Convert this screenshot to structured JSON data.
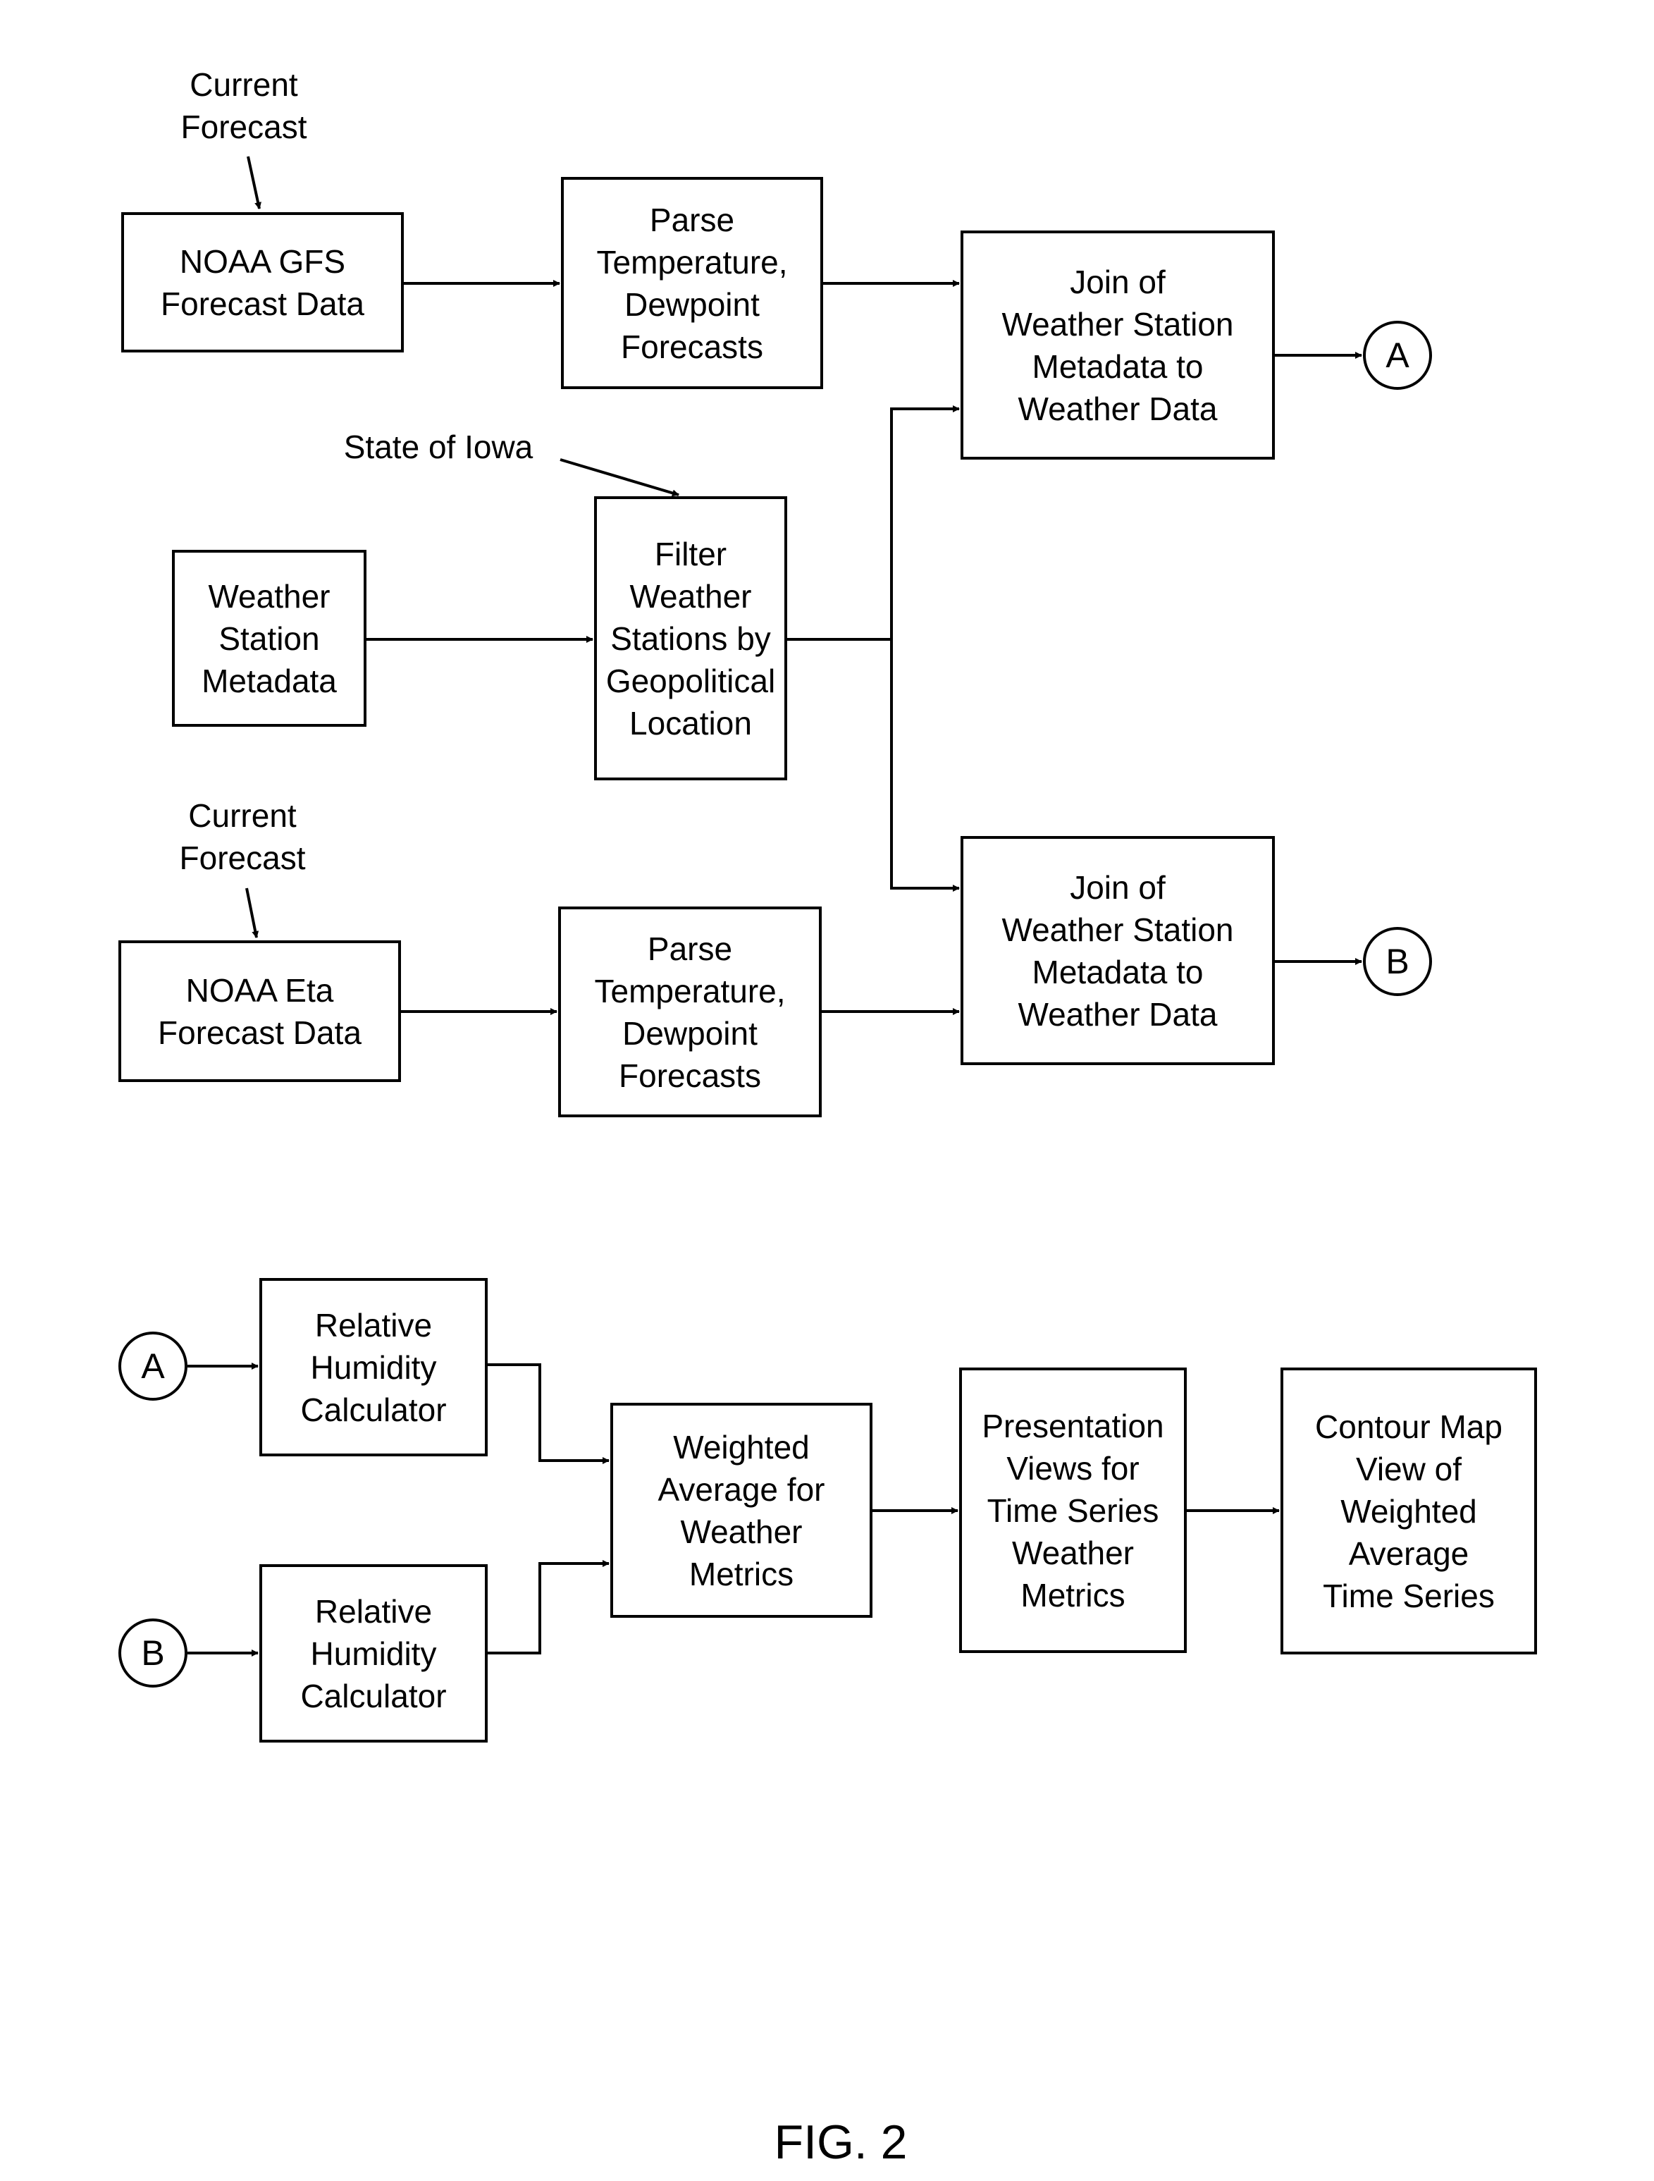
{
  "figure_label": "FIG. 2",
  "annotations": {
    "current_forecast_top": "Current\nForecast",
    "state_of_iowa": "State of Iowa",
    "current_forecast_bottom": "Current\nForecast"
  },
  "boxes": {
    "noaa_gfs": "NOAA GFS\nForecast Data",
    "parse_top": "Parse\nTemperature,\nDewpoint\nForecasts",
    "join_a": "Join of\nWeather Station\nMetadata to\nWeather Data",
    "weather_station_metadata": "Weather\nStation\nMetadata",
    "filter_stations": "Filter\nWeather\nStations by\nGeopolitical\nLocation",
    "noaa_eta": "NOAA Eta\nForecast Data",
    "parse_bottom": "Parse\nTemperature,\nDewpoint\nForecasts",
    "join_b": "Join of\nWeather Station\nMetadata to\nWeather Data",
    "rh_calc_a": "Relative\nHumidity\nCalculator",
    "rh_calc_b": "Relative\nHumidity\nCalculator",
    "weighted_average": "Weighted\nAverage for\nWeather\nMetrics",
    "presentation_views": "Presentation\nViews for\nTime Series\nWeather\nMetrics",
    "contour_map": "Contour Map\nView of\nWeighted\nAverage\nTime Series"
  },
  "connectors": {
    "a": "A",
    "b": "B"
  }
}
